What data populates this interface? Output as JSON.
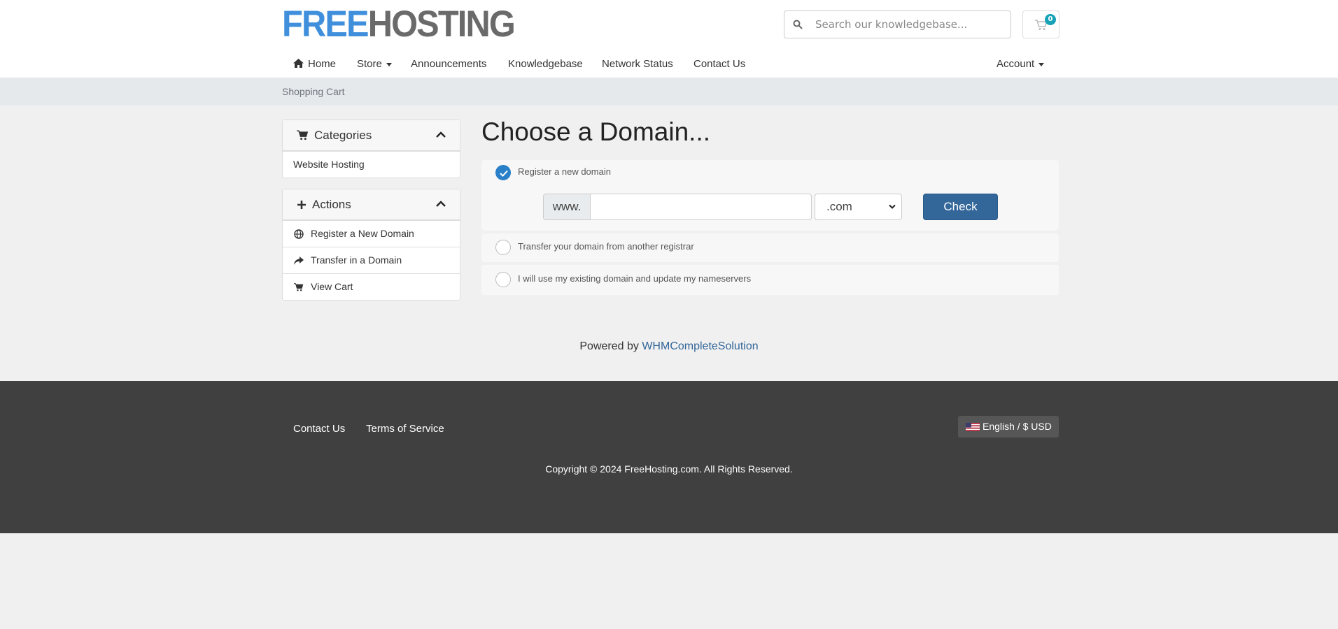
{
  "header": {
    "logo_part1": "FREE",
    "logo_part2": "HOSTING",
    "search_placeholder": "Search our knowledgebase...",
    "cart_count": "0"
  },
  "nav": {
    "home": "Home",
    "store": "Store",
    "announcements": "Announcements",
    "knowledgebase": "Knowledgebase",
    "network_status": "Network Status",
    "contact_us": "Contact Us",
    "account": "Account"
  },
  "breadcrumb": "Shopping Cart",
  "sidebar": {
    "categories_title": "Categories",
    "categories_items": [
      "Website Hosting"
    ],
    "actions_title": "Actions",
    "actions_items": [
      "Register a New Domain",
      "Transfer in a Domain",
      "View Cart"
    ]
  },
  "main": {
    "title": "Choose a Domain...",
    "options": [
      {
        "label": "Register a new domain",
        "checked": true
      },
      {
        "label": "Transfer your domain from another registrar",
        "checked": false
      },
      {
        "label": "I will use my existing domain and update my nameservers",
        "checked": false
      }
    ],
    "www_prefix": "www.",
    "domain_value": "",
    "tld_selected": ".com",
    "check_button": "Check"
  },
  "powered": {
    "prefix": "Powered by",
    "link": "WHMCompleteSolution"
  },
  "footer": {
    "links": [
      "Contact Us",
      "Terms of Service"
    ],
    "language": "English / $ USD",
    "copyright": "Copyright © 2024 FreeHosting.com. All Rights Reserved."
  },
  "colors": {
    "brand_blue": "#3f8fdc",
    "brand_gray": "#6a6a6a",
    "button_blue": "#336699",
    "footer_bg": "#404040",
    "badge_teal": "#17a2b8"
  }
}
